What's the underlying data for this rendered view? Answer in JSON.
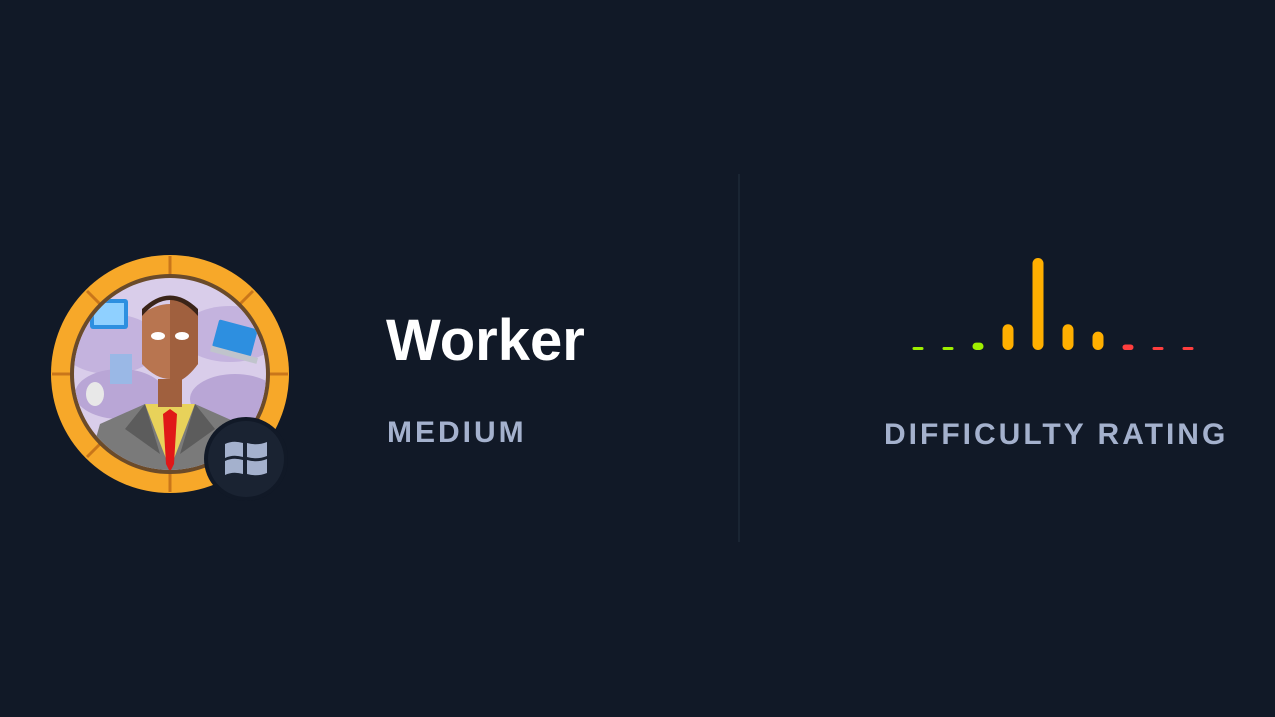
{
  "machine": {
    "name": "Worker",
    "difficulty": "MEDIUM",
    "os_icon": "windows-icon",
    "avatar_ring_color": "#f7a829"
  },
  "rating": {
    "title": "DIFFICULTY RATING",
    "bars": [
      {
        "level": 0.02,
        "color": "#9fef00"
      },
      {
        "level": 0.02,
        "color": "#9fef00"
      },
      {
        "level": 0.08,
        "color": "#9fef00"
      },
      {
        "level": 0.28,
        "color": "#ffaf00"
      },
      {
        "level": 1.0,
        "color": "#ffaf00"
      },
      {
        "level": 0.28,
        "color": "#ffaf00"
      },
      {
        "level": 0.2,
        "color": "#ffaf00"
      },
      {
        "level": 0.06,
        "color": "#ff3e3e"
      },
      {
        "level": 0.02,
        "color": "#ff3e3e"
      },
      {
        "level": 0.02,
        "color": "#ff3e3e"
      }
    ]
  },
  "colors": {
    "background": "#111927",
    "title": "#ffffff",
    "subtitle": "#a4b1cd",
    "easy": "#9fef00",
    "medium": "#ffaf00",
    "hard": "#ff3e3e"
  }
}
